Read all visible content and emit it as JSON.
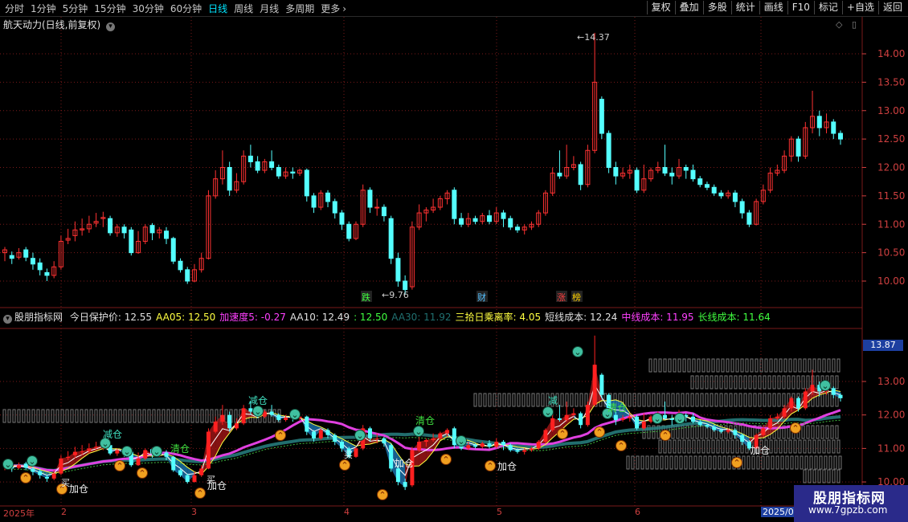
{
  "toolbar": {
    "periods": [
      "分时",
      "1分钟",
      "5分钟",
      "15分钟",
      "30分钟",
      "60分钟",
      "日线",
      "周线",
      "月线",
      "多周期",
      "更多"
    ],
    "active_period": "日线",
    "tools": [
      "复权",
      "叠加",
      "多股",
      "统计",
      "画线",
      "F10",
      "标记",
      "+自选",
      "返回"
    ]
  },
  "main_chart": {
    "title": "航天动力(日线,前复权)",
    "high_label": "14.37",
    "low_label": "9.76",
    "markers": [
      "跌",
      "财",
      "涨",
      "榜"
    ],
    "price_ticks": [
      "14.00",
      "13.50",
      "13.00",
      "12.50",
      "12.00",
      "11.50",
      "11.00",
      "10.50",
      "10.00"
    ]
  },
  "indicator": {
    "name": "股朋指标网",
    "items": [
      {
        "label": "今日保护价:",
        "value": "12.55",
        "color": "#e0e0e0"
      },
      {
        "label": "AA05:",
        "value": "12.50",
        "color": "#ffff40"
      },
      {
        "label": "加速度5:",
        "value": "-0.27",
        "color": "#ff40ff"
      },
      {
        "label": "AA10:",
        "value": "12.49",
        "color": "#e0e0e0"
      },
      {
        "label": ":",
        "value": "12.50",
        "color": "#40ff40"
      },
      {
        "label": "AA30:",
        "value": "11.92",
        "color": "#207070"
      },
      {
        "label": "三拾日乘离率:",
        "value": "4.05",
        "color": "#ffff40"
      },
      {
        "label": "短线成本:",
        "value": "12.24",
        "color": "#e0e0e0"
      },
      {
        "label": "中线成本:",
        "value": "11.95",
        "color": "#ff40ff"
      },
      {
        "label": "长线成本:",
        "value": "11.64",
        "color": "#40ff40"
      }
    ],
    "price_ticks": [
      "13.00",
      "12.00",
      "11.00",
      "10.00"
    ],
    "current_badge": "13.87",
    "signals": {
      "add": "加仓",
      "reduce": "减仓",
      "clear": "清仓",
      "reduce_short": "减",
      "buy": "买"
    }
  },
  "date_axis": {
    "labels": [
      "2025年",
      "2",
      "3",
      "4",
      "5",
      "6"
    ],
    "current": "2025/0"
  },
  "watermark": {
    "line1": "股朋指标网",
    "line2": "www.7gpzb.com"
  },
  "colors": {
    "up": "#ff3232",
    "down": "#54ffff",
    "grid": "#7a1a1a",
    "axis": "#d04040"
  }
}
